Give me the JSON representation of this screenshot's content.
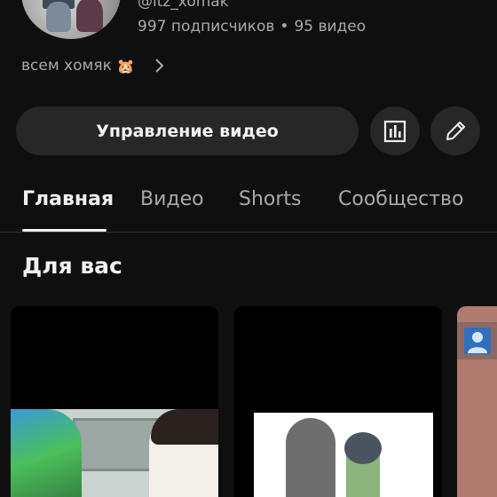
{
  "channel": {
    "handle": "@itz_xomak",
    "subscribers": "997 подписчиков",
    "separator": "•",
    "videos": "95 видео",
    "description": "всем хомяк",
    "description_emoji": "🐹"
  },
  "actions": {
    "manage_label": "Управление видео"
  },
  "tabs": [
    {
      "label": "Главная",
      "active": true
    },
    {
      "label": "Видео",
      "active": false
    },
    {
      "label": "Shorts",
      "active": false
    },
    {
      "label": "Сообщество",
      "active": false
    }
  ],
  "section": {
    "title": "Для вас"
  },
  "icons": {
    "about_chevron": "chevron-right-icon",
    "analytics": "analytics-icon",
    "edit": "pencil-icon",
    "thumbnail_person": "person-icon"
  },
  "colors": {
    "background": "#0f0f0f",
    "button": "#272727",
    "text_primary": "#f1f1f1",
    "text_secondary": "#aaaaaa"
  }
}
